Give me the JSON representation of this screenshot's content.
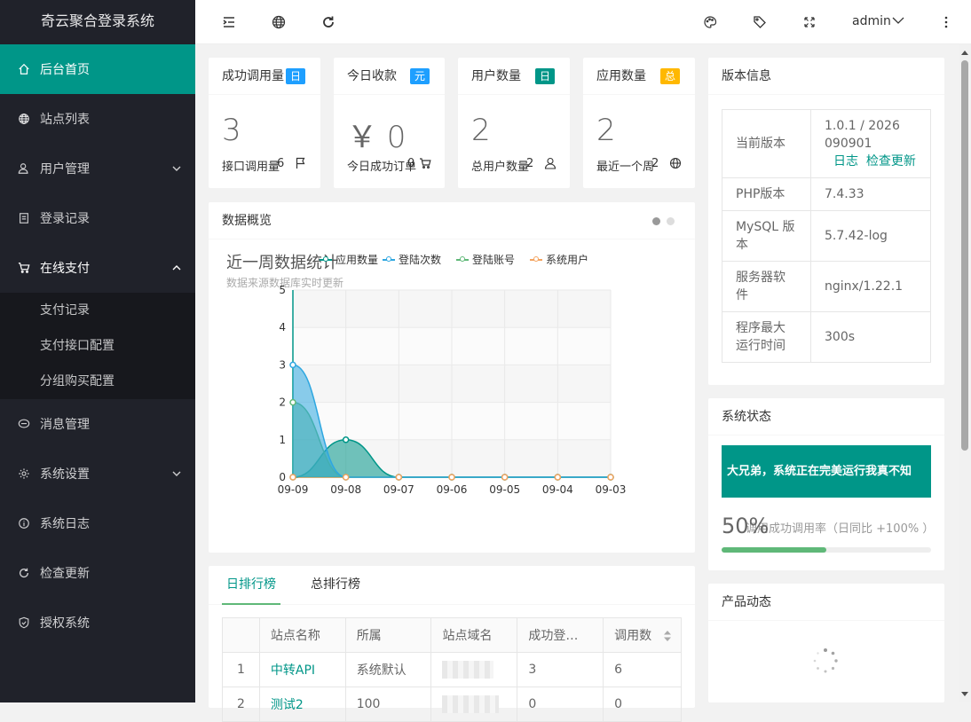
{
  "sidebar": {
    "logo": "奇云聚合登录系统",
    "items": [
      {
        "label": "后台首页"
      },
      {
        "label": "站点列表"
      },
      {
        "label": "用户管理"
      },
      {
        "label": "登录记录"
      },
      {
        "label": "在线支付"
      },
      {
        "label": "消息管理"
      },
      {
        "label": "系统设置"
      },
      {
        "label": "系统日志"
      },
      {
        "label": "检查更新"
      },
      {
        "label": "授权系统"
      }
    ],
    "pay_sub": [
      "支付记录",
      "支付接口配置",
      "分组购买配置"
    ]
  },
  "topbar": {
    "user": "admin"
  },
  "stats": [
    {
      "title": "成功调用量",
      "badge": "日",
      "badge_color": "#1e9fff",
      "value": "3",
      "sub": "接口调用量",
      "sub_val": "6"
    },
    {
      "title": "今日收款",
      "badge": "元",
      "badge_color": "#1e9fff",
      "value": "￥ 0",
      "sub": "今日成功订单",
      "sub_val": "0"
    },
    {
      "title": "用户数量",
      "badge": "日",
      "badge_color": "#009688",
      "value": "2",
      "sub": "总用户数量",
      "sub_val": "2"
    },
    {
      "title": "应用数量",
      "badge": "总",
      "badge_color": "#ffb800",
      "value": "2",
      "sub": "最近一个周",
      "sub_val": "2"
    }
  ],
  "overview": {
    "title": "数据概览"
  },
  "chart_data": {
    "type": "area",
    "title": "近一周数据统计",
    "subtitle": "数据来源数据库实时更新",
    "categories": [
      "09-09",
      "09-08",
      "09-07",
      "09-06",
      "09-05",
      "09-04",
      "09-03"
    ],
    "ylim": [
      0,
      5
    ],
    "yticks": [
      "0",
      "1",
      "2",
      "3",
      "4",
      "5"
    ],
    "legend_position": "top",
    "series": [
      {
        "name": "应用数量",
        "color": "#009688",
        "values": [
          0,
          1,
          0,
          0,
          0,
          0,
          0
        ]
      },
      {
        "name": "登陆次数",
        "color": "#2ea7e0",
        "values": [
          3,
          0,
          0,
          0,
          0,
          0,
          0
        ]
      },
      {
        "name": "登陆账号",
        "color": "#5fb878",
        "values": [
          2,
          0,
          0,
          0,
          0,
          0,
          0
        ]
      },
      {
        "name": "系统用户",
        "color": "#f4a460",
        "values": [
          0,
          0,
          0,
          0,
          0,
          0,
          0
        ]
      }
    ]
  },
  "rank": {
    "tabs": [
      "日排行榜",
      "总排行榜"
    ],
    "headers": [
      "",
      "站点名称",
      "所属",
      "站点域名",
      "成功登…",
      "调用数"
    ],
    "rows": [
      {
        "no": "1",
        "name": "中转API",
        "owner": "系统默认",
        "success": "3",
        "calls": "6"
      },
      {
        "no": "2",
        "name": "测试2",
        "owner": "100",
        "success": "0",
        "calls": "0"
      }
    ]
  },
  "version": {
    "title": "版本信息",
    "rows": [
      {
        "k": "当前版本",
        "v": "1.0.1 / 2026090901"
      },
      {
        "k": "PHP版本",
        "v": "7.4.33"
      },
      {
        "k": "MySQL 版本",
        "v": "5.7.42-log"
      },
      {
        "k": "服务器软件",
        "v": "nginx/1.22.1"
      },
      {
        "k": "程序最大运行时间",
        "v": "300s"
      }
    ],
    "link_log": "日志",
    "link_update": "检查更新"
  },
  "system": {
    "title": "系统状态",
    "banner": "大兄弟，系统正在完美运行我真不知",
    "percent": "50%",
    "progress": 0.5,
    "desc": "调用成功调用率（日同比 +100% ）"
  },
  "product": {
    "title": "产品动态"
  }
}
